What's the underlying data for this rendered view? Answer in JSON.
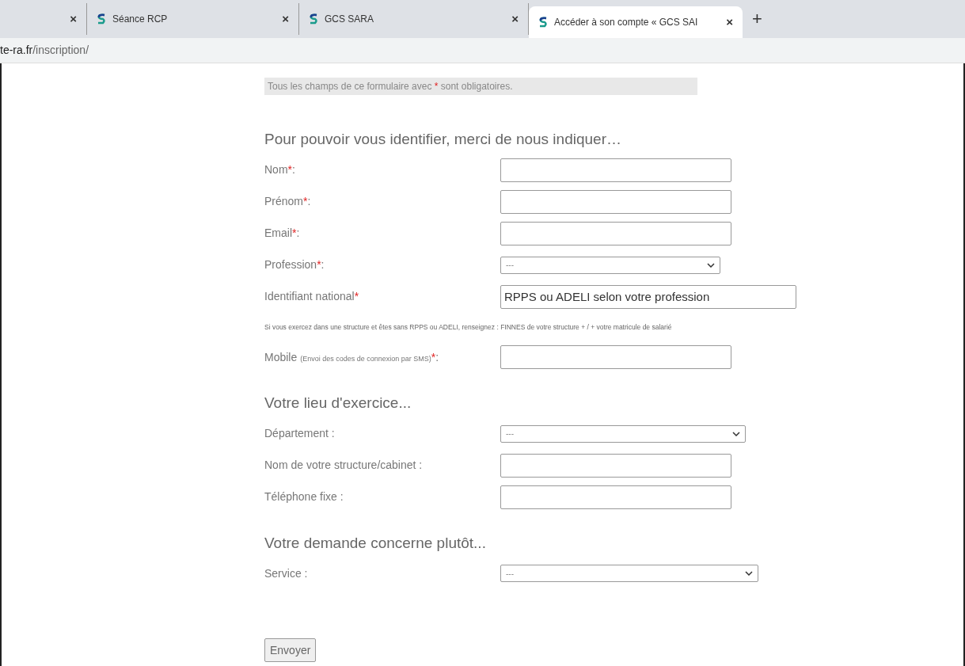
{
  "tabs": [
    {
      "selected": false,
      "close": "×"
    },
    {
      "title": "Séance RCP",
      "selected": false,
      "close": "×"
    },
    {
      "title": "GCS SARA",
      "selected": false,
      "close": "×"
    },
    {
      "title": "Accéder à son compte « GCS SAI",
      "selected": true,
      "close": "×"
    }
  ],
  "new_tab": "+",
  "address": {
    "host": "te-ra.fr",
    "path": "/inscription/"
  },
  "notice": {
    "before": "Tous les champs de ce formulaire avec ",
    "star": "*",
    "after": " sont obligatoires."
  },
  "sections": [
    {
      "heading": "Pour pouvoir vous identifier, merci de nous indiquer…",
      "fields": [
        {
          "kind": "text",
          "label": "Nom",
          "required": true,
          "suffix": ":"
        },
        {
          "kind": "text",
          "label": "Prénom",
          "required": true,
          "suffix": ":"
        },
        {
          "kind": "text",
          "label": "Email",
          "required": true,
          "suffix": ":"
        },
        {
          "kind": "select",
          "label": "Profession",
          "required": true,
          "suffix": ":",
          "value": "---"
        },
        {
          "kind": "text",
          "label": "Identifiant national",
          "required": true,
          "placeholder": "RPPS ou ADELI selon votre profession"
        },
        {
          "kind": "help",
          "text": "Si vous exercez dans une structure et êtes sans RPPS ou ADELI, renseignez : FINNES de votre structure + / + votre matricule de salarié"
        },
        {
          "kind": "text",
          "label": "Mobile",
          "note": "(Envoi des codes de connexion par SMS)",
          "required": true,
          "suffix": ":"
        }
      ]
    },
    {
      "heading": "Votre lieu d'exercice...",
      "fields": [
        {
          "kind": "select",
          "label": "Département :",
          "required": false,
          "value": "---"
        },
        {
          "kind": "text",
          "label": "Nom de votre structure/cabinet :",
          "required": false
        },
        {
          "kind": "text",
          "label": "Téléphone fixe :",
          "required": false
        }
      ]
    },
    {
      "heading": "Votre demande concerne plutôt...",
      "fields": [
        {
          "kind": "select",
          "label": "Service :",
          "required": false,
          "value": "---"
        }
      ]
    }
  ],
  "submit": "Envoyer"
}
